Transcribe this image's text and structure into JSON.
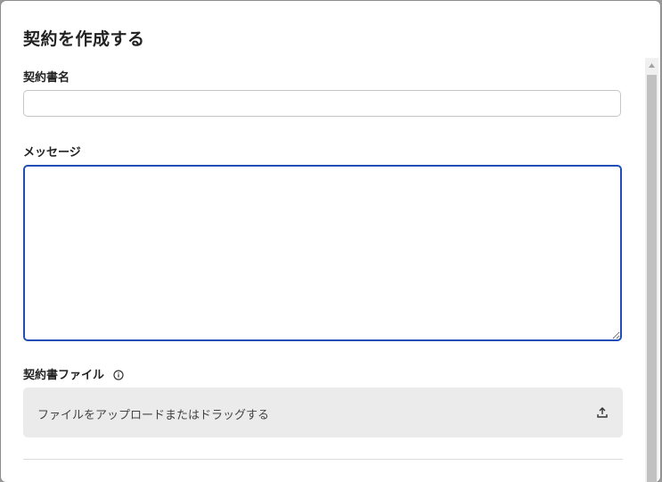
{
  "dialog": {
    "title": "契約を作成する"
  },
  "form": {
    "contract_name_label": "契約書名",
    "contract_name_value": "",
    "message_label": "メッセージ",
    "message_value": "",
    "file_label": "契約書ファイル",
    "upload_text": "ファイルをアップロードまたはドラッグする"
  },
  "icons": {
    "info": "info-circle-icon",
    "upload": "upload-icon",
    "scroll_up": "triangle-up-icon"
  },
  "colors": {
    "focus_border": "#1f4fb5",
    "upload_bg": "#ebebeb",
    "title_text": "#222222"
  }
}
